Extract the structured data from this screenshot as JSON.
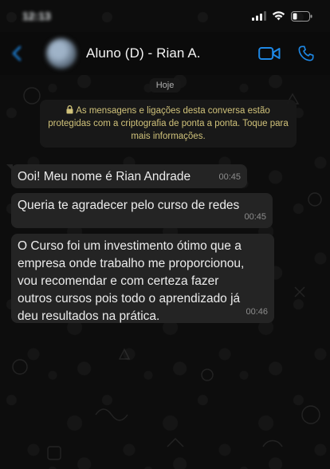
{
  "status": {
    "time": "12:13"
  },
  "header": {
    "contact_name": "Aluno (D) - Rian A.",
    "icons": [
      "back-chevron-icon",
      "video-call-icon",
      "voice-call-icon"
    ]
  },
  "chat": {
    "day_label": "Hoje",
    "encryption_note": "As mensagens e ligações desta conversa estão protegidas com a criptografia de ponta a ponta. Toque para mais informações.",
    "messages": [
      {
        "text": "Ooi! Meu nome é Rian Andrade",
        "time": "00:45"
      },
      {
        "text": "Queria te agradecer pelo curso de redes",
        "time": "00:45"
      },
      {
        "text": "O Curso foi um investimento ótimo que a\nempresa onde trabalho me proporcionou,\nvou recomendar e com certeza fazer\noutros cursos pois todo o aprendizado já\ndeu resultados na prática.",
        "time": "00:46"
      }
    ]
  },
  "colors": {
    "accent": "#1e88e5",
    "bubble": "#242424",
    "note_text": "#d0c27a"
  }
}
